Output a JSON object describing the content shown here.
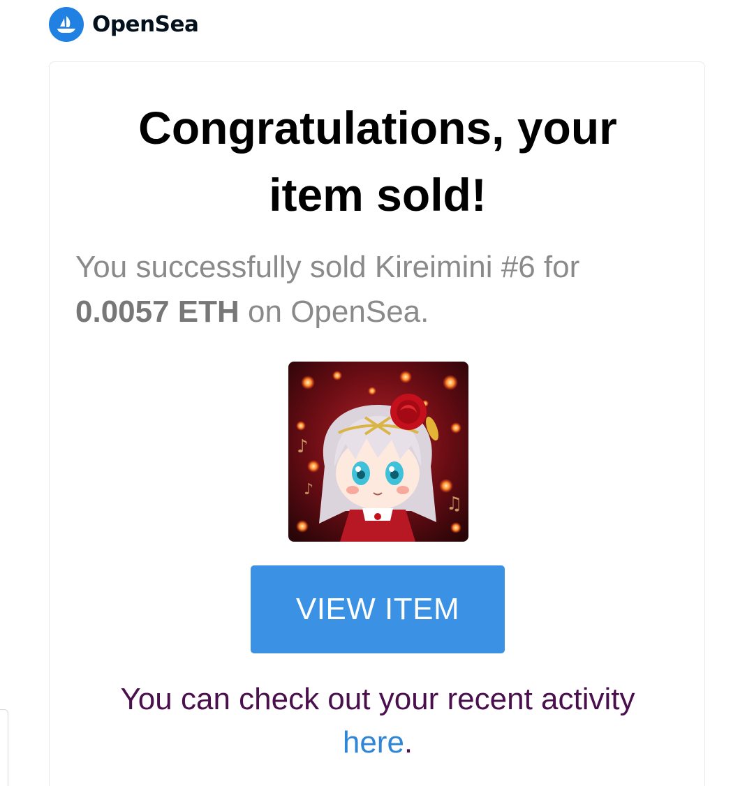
{
  "brand": {
    "name": "OpenSea",
    "color": "#2081e2"
  },
  "email": {
    "headline_line1": "Congratulations, your",
    "headline_line2": "item sold!",
    "message_before": "You successfully sold Kireimini #6 for",
    "amount": "0.0057 ETH",
    "message_after": " on OpenSea.",
    "image_alt": "Kireimini #6",
    "button_label": "VIEW ITEM",
    "button_color": "#3b91e4",
    "activity_text": "You can check out your recent activity",
    "activity_link": "here",
    "activity_end": "."
  }
}
